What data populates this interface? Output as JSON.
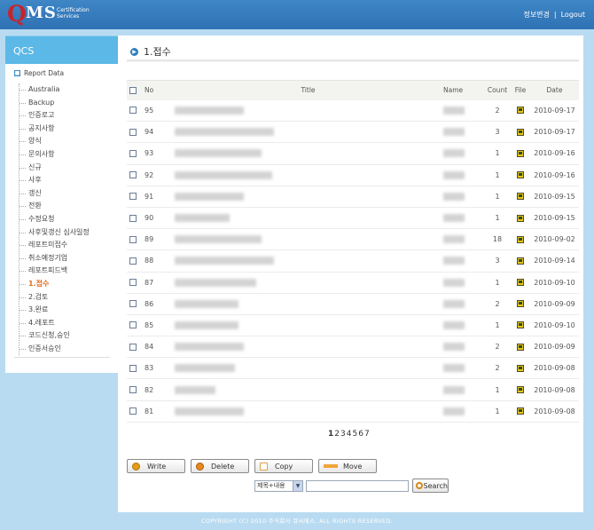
{
  "header": {
    "logo_q": "Q",
    "logo_ms": "MS",
    "logo_sub": "Certification Services",
    "links": [
      "정보변경",
      "Logout"
    ],
    "separator": "|"
  },
  "sidebar": {
    "title": "QCS",
    "root_label": "Report Data",
    "items": [
      {
        "label": "Australia"
      },
      {
        "label": "Backup"
      },
      {
        "label": "인증로고"
      },
      {
        "label": "공지사항"
      },
      {
        "label": "양식"
      },
      {
        "label": "문의사항"
      },
      {
        "label": "신규"
      },
      {
        "label": "사후"
      },
      {
        "label": "갱신"
      },
      {
        "label": "전환"
      },
      {
        "label": "수정요청"
      },
      {
        "label": "사후및갱신 심사일정"
      },
      {
        "label": "레포트미접수"
      },
      {
        "label": "취소예정기업"
      },
      {
        "label": "레포트피드백"
      },
      {
        "label": "1.접수"
      },
      {
        "label": "2.검토"
      },
      {
        "label": "3.완료"
      },
      {
        "label": "4.레포트"
      },
      {
        "label": "코드신청,승인"
      },
      {
        "label": "인증서승인"
      }
    ],
    "active_index": 15
  },
  "main": {
    "title": "1.접수",
    "columns": {
      "no": "No",
      "title": "Title",
      "name": "Name",
      "count": "Count",
      "file": "File",
      "date": "Date"
    },
    "rows": [
      {
        "no": "95",
        "count": "2",
        "date": "2010-09-17"
      },
      {
        "no": "94",
        "count": "3",
        "date": "2010-09-17"
      },
      {
        "no": "93",
        "count": "1",
        "date": "2010-09-16"
      },
      {
        "no": "92",
        "count": "1",
        "date": "2010-09-16"
      },
      {
        "no": "91",
        "count": "1",
        "date": "2010-09-15"
      },
      {
        "no": "90",
        "count": "1",
        "date": "2010-09-15"
      },
      {
        "no": "89",
        "count": "18",
        "date": "2010-09-02"
      },
      {
        "no": "88",
        "count": "3",
        "date": "2010-09-14"
      },
      {
        "no": "87",
        "count": "1",
        "date": "2010-09-10"
      },
      {
        "no": "86",
        "count": "2",
        "date": "2010-09-09"
      },
      {
        "no": "85",
        "count": "1",
        "date": "2010-09-10"
      },
      {
        "no": "84",
        "count": "2",
        "date": "2010-09-09"
      },
      {
        "no": "83",
        "count": "2",
        "date": "2010-09-08"
      },
      {
        "no": "82",
        "count": "1",
        "date": "2010-09-08"
      },
      {
        "no": "81",
        "count": "1",
        "date": "2010-09-08"
      }
    ],
    "pages": [
      "1",
      "2",
      "3",
      "4",
      "5",
      "6",
      "7"
    ],
    "current_page": "1",
    "actions": {
      "write": "Write",
      "delete": "Delete",
      "copy": "Copy",
      "move": "Move"
    },
    "search": {
      "select_value": "제목+내용",
      "keyword": "",
      "button": "Search"
    }
  },
  "footer": {
    "copyright": "COPYRIGHT (C) 2010 주식회사 큐씨에스. ALL RIGHTS RESERVED."
  }
}
